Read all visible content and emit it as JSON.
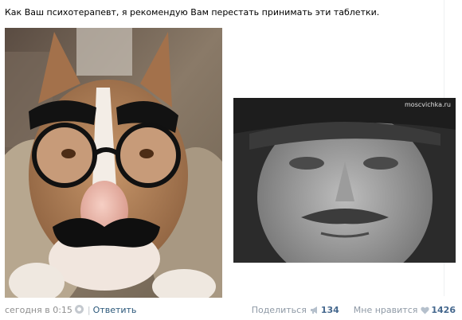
{
  "post": {
    "text": "Как Ваш психотерапевт, я рекомендую Вам перестать принимать эти таблетки."
  },
  "images": {
    "dog_watermark": "",
    "man_watermark": "moscvichka.ru"
  },
  "footer": {
    "date": "сегодня в 0:15",
    "separator": "|",
    "reply": "Ответить",
    "share_label": "Поделиться",
    "share_count": "134",
    "like_label": "Мне нравится",
    "like_count": "1426"
  },
  "colors": {
    "link": "#2b587a",
    "count": "#45688e",
    "muted": "#8f8f8f"
  },
  "icons": {
    "settings": "gear-icon",
    "share": "megaphone-icon",
    "like": "heart-icon"
  }
}
